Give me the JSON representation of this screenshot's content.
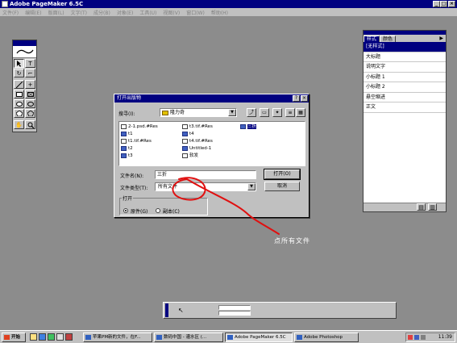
{
  "window": {
    "title": "Adobe PageMaker 6.5C"
  },
  "menu": [
    "文件(F)",
    "编辑(E)",
    "版面(L)",
    "文字(T)",
    "成分(B)",
    "对象(E)",
    "工具(U)",
    "视图(V)",
    "窗口(W)",
    "帮助(H)"
  ],
  "toolbox": {
    "tools": [
      "pointer",
      "text",
      "rotate",
      "crop",
      "line",
      "constrained-line",
      "rectangle",
      "rectangle-frame",
      "ellipse",
      "ellipse-frame",
      "polygon",
      "polygon-frame",
      "hand",
      "zoom"
    ]
  },
  "styles_palette": {
    "tabs": [
      "样式",
      "颜色"
    ],
    "items": [
      "[无样式]",
      "大标题",
      "说明文字",
      "小标题 1",
      "小标题 2",
      "悬空缩进",
      "正文"
    ],
    "selected_index": 0
  },
  "dialog": {
    "title": "打开出版物",
    "help_btn": "?",
    "close_btn": "×",
    "search_label": "搜寻(I):",
    "search_value": "隆力奇",
    "files": [
      {
        "name": "2-1.psd.#Res",
        "icon": "doc"
      },
      {
        "name": "t1",
        "icon": "pm"
      },
      {
        "name": "t1.tif.#Res",
        "icon": "doc"
      },
      {
        "name": "t2",
        "icon": "pm"
      },
      {
        "name": "t3",
        "icon": "pm"
      },
      {
        "name": "t3.tif.#Res",
        "icon": "doc"
      },
      {
        "name": "t4",
        "icon": "pm"
      },
      {
        "name": "t4.tif.#Res",
        "icon": "doc"
      },
      {
        "name": "Untitled-1",
        "icon": "pm"
      },
      {
        "name": "软发",
        "icon": "doc"
      },
      {
        "name": "三折",
        "icon": "pm"
      }
    ],
    "selected_file": "三折",
    "filename_label": "文件名(N):",
    "filename_value": "三折",
    "filetype_label": "文件类型(T):",
    "filetype_value": "所有文件",
    "open_btn": "打开(O)",
    "cancel_btn": "取消",
    "open_group_label": "打开",
    "radio_original": "原件(G)",
    "radio_copy": "副本(C)",
    "radio_selected": "original"
  },
  "annotation": {
    "text": "点所有文件",
    "color": "#e01010"
  },
  "taskbar": {
    "start": "开始",
    "items": [
      {
        "label": "苹果PM新的文件，在F..."
      },
      {
        "label": "数码中国 - 灌水区 (..."
      },
      {
        "label": "Adobe PageMaker 6.5C"
      },
      {
        "label": "Adobe Photoshop"
      }
    ],
    "active_index": 2,
    "clock": "11:39"
  },
  "colors": {
    "desktop": "#8c8c8c",
    "titlebar": "#000080",
    "face": "#c0c0c0"
  }
}
